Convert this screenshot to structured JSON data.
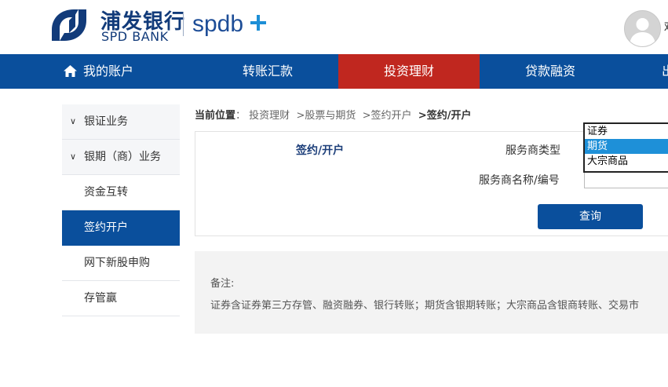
{
  "brand": {
    "name_cn": "浦发银行",
    "name_en": "SPD BANK",
    "sub_brand": "spdb",
    "color": "#123b7a"
  },
  "user": {
    "name_fragment": "欢"
  },
  "nav": {
    "items": [
      {
        "label": "我的账户",
        "icon": "home-icon"
      },
      {
        "label": "转账汇款"
      },
      {
        "label": "投资理财",
        "active": true
      },
      {
        "label": "贷款融资"
      },
      {
        "label": "出"
      }
    ],
    "bg_color": "#0a4f9c",
    "active_color": "#c0271f"
  },
  "sidebar": {
    "items": [
      {
        "label": "银证业务",
        "type": "group",
        "icon": "chevron-down-icon"
      },
      {
        "label": "银期（商）业务",
        "type": "group",
        "icon": "chevron-down-icon"
      },
      {
        "label": "资金互转",
        "type": "sub"
      },
      {
        "label": "签约开户",
        "type": "sub",
        "active": true
      },
      {
        "label": "网下新股申购",
        "type": "sub"
      },
      {
        "label": "存管赢",
        "type": "sub"
      }
    ]
  },
  "breadcrumb": {
    "prefix": "当前位置",
    "sep": "：",
    "path": [
      "投资理财",
      ">股票与期货",
      ">签约开户"
    ],
    "current": ">签约/开户"
  },
  "form": {
    "title": "签约/开户",
    "type_label": "服务商类型",
    "name_label": "服务商名称/编号",
    "name_value": "",
    "type_options": [
      "证券",
      "期货",
      "大宗商品"
    ],
    "type_selected": "期货",
    "submit_label": "查询"
  },
  "note": {
    "title": "备注:",
    "text": "证券含证券第三方存管、融资融券、银行转账；期货含银期转账；大宗商品含银商转账、交易市"
  }
}
